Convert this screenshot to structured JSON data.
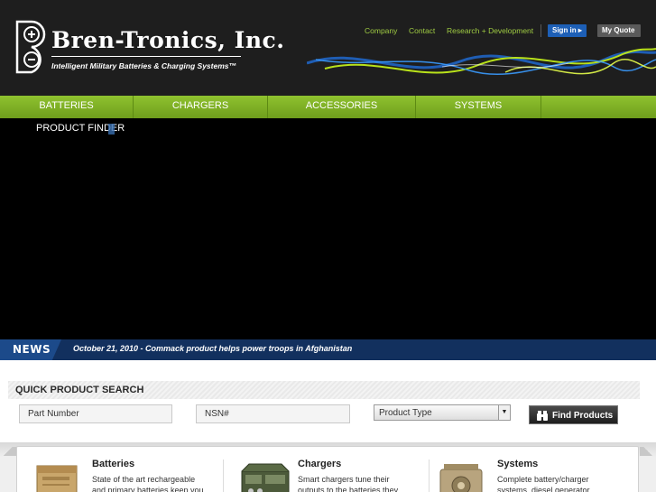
{
  "brand": {
    "name": "Bren-Tronics, Inc.",
    "tagline": "Intelligent Military Batteries & Charging Systems™"
  },
  "top_links": [
    "Company",
    "Contact",
    "Research + Development"
  ],
  "signin_label": "Sign in ▸",
  "quote_label": "My Quote",
  "nav": [
    "BATTERIES",
    "CHARGERS",
    "ACCESSORIES",
    "SYSTEMS"
  ],
  "banner": {
    "finder_label": "PRODUCT FINDER"
  },
  "news": {
    "label": "NEWS",
    "headline": "October 21, 2010 - Commack product helps power troops in Afghanistan"
  },
  "search": {
    "title": "QUICK PRODUCT SEARCH",
    "part_placeholder": "Part Number",
    "nsn_placeholder": "NSN#",
    "type_value": "Product Type",
    "button_label": "Find Products"
  },
  "categories": [
    {
      "title": "Batteries",
      "lines": [
        "State of the art rechargeable",
        "and primary batteries keep you"
      ]
    },
    {
      "title": "Chargers",
      "lines": [
        "Smart chargers tune their",
        "outputs to the batteries they"
      ]
    },
    {
      "title": "Systems",
      "lines": [
        "Complete battery/charger",
        "systems, diesel generator"
      ]
    }
  ],
  "colors": {
    "nav_green": "#7fb027",
    "link_green": "#9fcb42",
    "news_blue": "#12305e",
    "signin_blue": "#1d5fb6"
  }
}
